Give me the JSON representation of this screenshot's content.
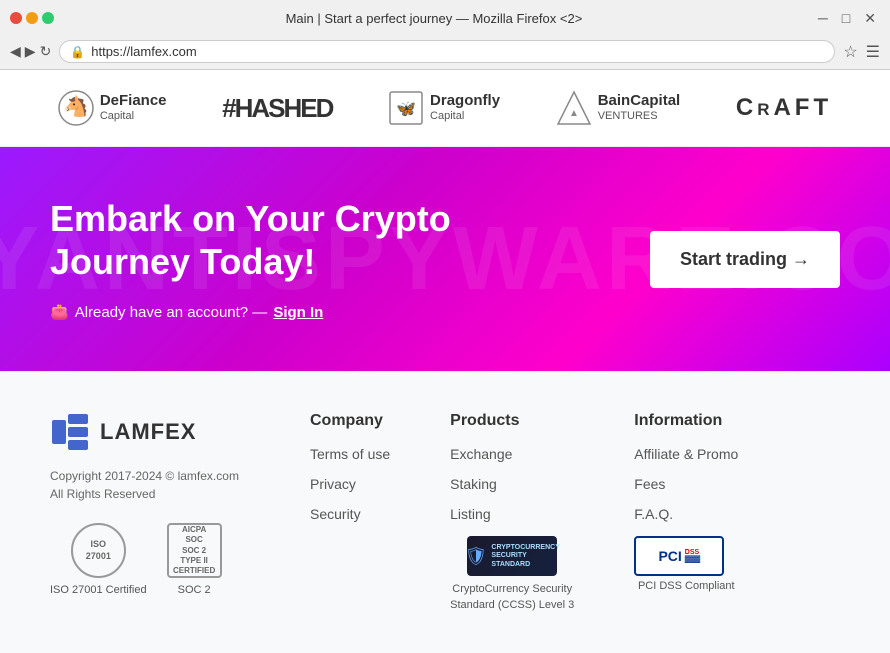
{
  "browser": {
    "title": "Main | Start a perfect journey — Mozilla Firefox <2>",
    "url": "https://lamfex.com",
    "favicon": "🦊"
  },
  "partners": [
    {
      "id": "defiance",
      "line1": "DeFiance",
      "line2": "Capital",
      "icon": "horse"
    },
    {
      "id": "hashed",
      "name": "#HASHED",
      "icon": "hash"
    },
    {
      "id": "dragonfly",
      "line1": "Dragonfly",
      "line2": "Capital",
      "icon": "dragonfly"
    },
    {
      "id": "baincapital",
      "line1": "BainCapital",
      "line2": "VENTURES",
      "icon": "bain"
    },
    {
      "id": "craft",
      "name": "CrAFT",
      "icon": "craft"
    }
  ],
  "hero": {
    "title": "Embark on Your Crypto Journey Today!",
    "watermark": "MYANTISPYWARE.COM",
    "signin_text": "Already have an account? —",
    "signin_link": "Sign In",
    "cta_button": "Start trading →"
  },
  "footer": {
    "brand": {
      "name": "LAMFEX",
      "copyright": "Copyright 2017-2024 © lamfex.com\nAll Rights Reserved"
    },
    "certs": [
      {
        "id": "iso",
        "label": "ISO 27001 Certified",
        "badge_text": "ISO\n27001"
      },
      {
        "id": "soc2",
        "label": "SOC 2",
        "badge_text": "AICPA\nSOC\nSOC 2\nTYPE II\nCERTIFIED"
      }
    ],
    "columns": [
      {
        "id": "company",
        "heading": "Company",
        "links": [
          "Terms of use",
          "Privacy",
          "Security"
        ]
      },
      {
        "id": "products",
        "heading": "Products",
        "links": [
          "Exchange",
          "Staking",
          "Listing"
        ],
        "extra": {
          "ccss_label": "CryptoCurrency Security\nStandard (CCSS) Level 3"
        }
      },
      {
        "id": "information",
        "heading": "Information",
        "links": [
          "Affiliate & Promo",
          "Fees",
          "F.A.Q."
        ],
        "extra": {
          "pci_label": "PCI DSS Compliant"
        }
      }
    ]
  }
}
